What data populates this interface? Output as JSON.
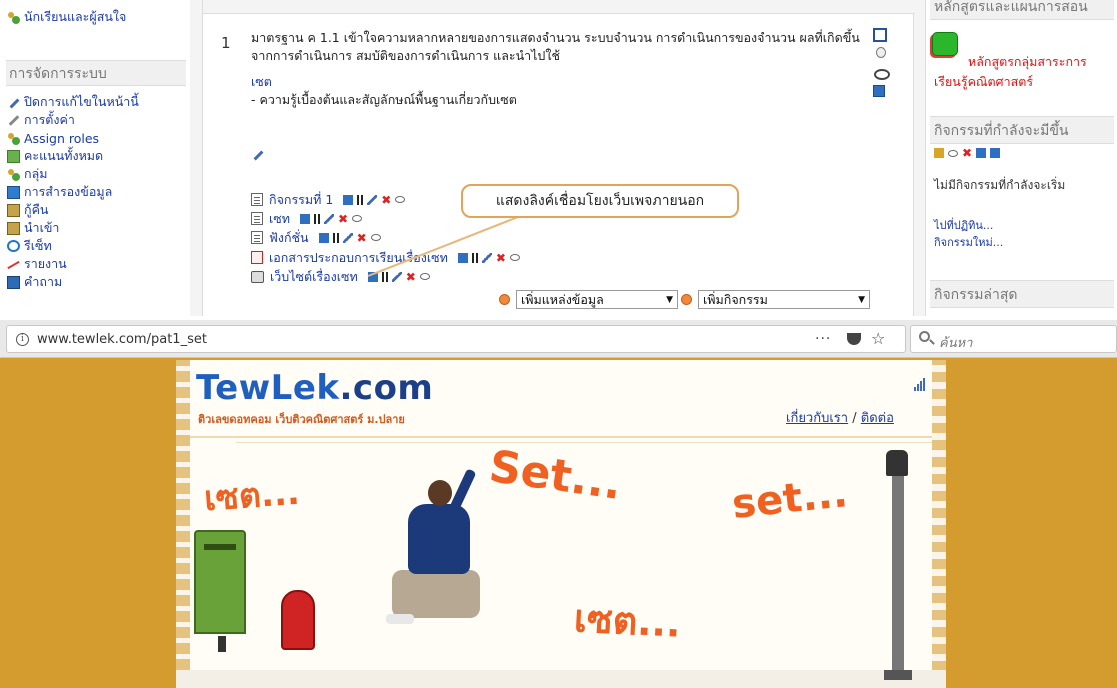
{
  "moodle": {
    "left_column": {
      "participants": "นักเรียนและผู้สนใจ",
      "admin_header": "การจัดการระบบ",
      "admin_items": [
        {
          "label": "ปิดการแก้ไขในหน้านี้",
          "icon": "pencil-icon"
        },
        {
          "label": "การตั้งค่า",
          "icon": "wrench-icon"
        },
        {
          "label": "Assign roles",
          "icon": "people-icon"
        },
        {
          "label": "คะแนนทั้งหมด",
          "icon": "grades-icon"
        },
        {
          "label": "กลุ่ม",
          "icon": "group-icon"
        },
        {
          "label": "การสำรองข้อมูล",
          "icon": "save-icon"
        },
        {
          "label": "กู้คืน",
          "icon": "restore-icon"
        },
        {
          "label": "นำเข้า",
          "icon": "import-icon"
        },
        {
          "label": "รีเซ็ท",
          "icon": "reset-icon"
        },
        {
          "label": "รายงาน",
          "icon": "report-icon"
        },
        {
          "label": "คำถาม",
          "icon": "questions-icon"
        }
      ]
    },
    "center": {
      "topic_number": "1",
      "standard_text": "มาตรฐาน ค 1.1 เข้าใจความหลากหลายของการแสดงจำนวน ระบบจำนวน การดำเนินการของจำนวน ผลที่เกิดขึ้นจากการดำเนินการ สมบัติของการดำเนินการ และนำไปใช้",
      "set_link": "เซต",
      "set_desc": "- ความรู้เบื้องต้นและสัญลักษณ์พื้นฐานเกี่ยวกับเซต",
      "activities": [
        {
          "label": "กิจกรรมที่ 1",
          "icon": "file-icon"
        },
        {
          "label": "เซท",
          "icon": "file-icon"
        },
        {
          "label": "ฟังก์ชั่น",
          "icon": "file-icon"
        },
        {
          "label": "เอกสารประกอบการเรียนเรื่องเซท",
          "icon": "pdf-icon"
        },
        {
          "label": "เว็บไซต์เรื่องเซท",
          "icon": "web-icon"
        }
      ],
      "callout": "แสดงลิงค์เชื่อมโยงเว็บเพจภายนอก",
      "add_resource": "เพิ่มแหล่งข้อมูล",
      "add_activity": "เพิ่มกิจกรรม"
    },
    "right_column": {
      "curriculum_header": "หลักสูตรและแผนการสอน",
      "curriculum_link_1": "หลักสูตรกลุ่มสาระการ",
      "curriculum_link_2": "เรียนรู้คณิตศาสตร์",
      "upcoming_header": "กิจกรรมที่กำลังจะมีขึ้น",
      "upcoming_none": "ไม่มีกิจกรรมที่กำลังจะเริ่ม",
      "calendar_link": "ไปที่ปฏิทิน...",
      "new_event_link": "กิจกรรมใหม่...",
      "recent_header": "กิจกรรมล่าสุด"
    }
  },
  "browser": {
    "url": "www.tewlek.com/pat1_set",
    "dots": "···",
    "search_placeholder": "ค้นหา",
    "site": {
      "logo_tew": "Tew",
      "logo_lek": "Lek",
      "logo_com": ".com",
      "tagline": "ติวเลขดอทคอม เว็บติวคณิตศาสตร์ ม.ปลาย",
      "about_link": "เกี่ยวกับเรา",
      "separator": "/",
      "contact_link": "ติดต่อ",
      "word_1": "เซต...",
      "word_2": "Set...",
      "word_3": "set...",
      "word_4": "เซต..."
    }
  }
}
